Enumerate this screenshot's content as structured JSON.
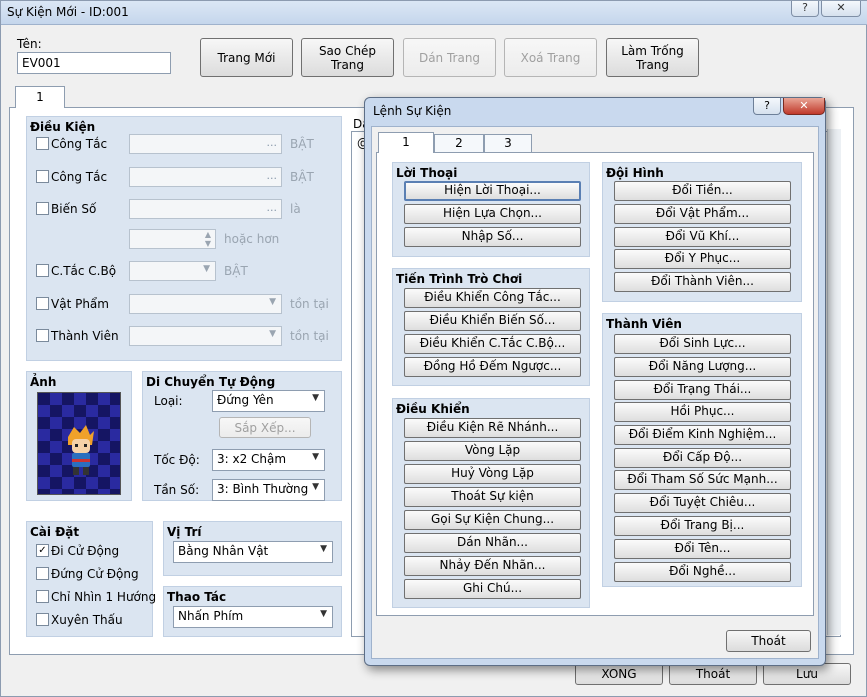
{
  "window": {
    "title": "Sự Kiện Mới - ID:001",
    "help_label": "?",
    "close_label": "✕"
  },
  "name_label": "Tên:",
  "name_value": "EV001",
  "toolbar": {
    "new_page": "Trang Mới",
    "copy_page": "Sao Chép Trang",
    "paste_page": "Dán Trang",
    "delete_page": "Xoá Trang",
    "clear_page": "Làm Trống Trang"
  },
  "page_tab": "1",
  "conditions": {
    "title": "Điều Kiện",
    "switch1_label": "Công Tắc",
    "switch1_suffix": "BẬT",
    "switch2_label": "Công Tắc",
    "switch2_suffix": "BẬT",
    "variable_label": "Biến Số",
    "variable_suffix": "là",
    "or_more": "hoặc hơn",
    "self_switch_label": "C.Tắc C.Bộ",
    "self_switch_suffix": "BẬT",
    "item_label": "Vật Phẩm",
    "item_suffix": "tồn tại",
    "actor_label": "Thành Viên",
    "actor_suffix": "tồn tại",
    "dots": "..."
  },
  "image": {
    "title": "Ảnh"
  },
  "autonomous": {
    "title": "Di Chuyển Tự Động",
    "type_label": "Loại:",
    "type_value": "Đứng Yên",
    "route_button": "Sắp Xếp...",
    "speed_label": "Tốc Độ:",
    "speed_value": "3: x2 Chậm",
    "freq_label": "Tần Số:",
    "freq_value": "3: Bình Thường"
  },
  "options": {
    "title": "Cài Đặt",
    "walking_anim": "Đi Cử Động",
    "stepping_anim": "Đứng Cử Động",
    "direction_fix": "Chỉ Nhìn 1 Hướng",
    "through": "Xuyên Thấu",
    "walking_checked": "✓"
  },
  "priority": {
    "title": "Vị Trí",
    "value": "Bằng Nhân Vật"
  },
  "trigger": {
    "title": "Thao Tác",
    "value": "Nhấn Phím"
  },
  "contents_label_partial": "Da",
  "contents_at": "@",
  "footer": {
    "ok": "XONG",
    "cancel": "Thoát",
    "apply": "Lưu"
  },
  "dialog": {
    "title": "Lệnh Sự Kiện",
    "help_label": "?",
    "close_label": "✕",
    "tabs": [
      "1",
      "2",
      "3"
    ],
    "message": {
      "title": "Lời Thoại",
      "items": [
        "Hiện Lời Thoại...",
        "Hiện Lựa Chọn...",
        "Nhập Số..."
      ]
    },
    "game_progression": {
      "title": "Tiến Trình Trò Chơi",
      "items": [
        "Điều Khiển Công Tắc...",
        "Điều Khiển Biến Số...",
        "Điều Khiển C.Tắc C.Bộ...",
        "Đồng Hồ Đếm Ngược..."
      ]
    },
    "flow_control": {
      "title": "Điều Khiển",
      "items": [
        "Điều Kiện Rẽ Nhánh...",
        "Vòng Lặp",
        "Huỷ Vòng Lặp",
        "Thoát Sự kiện",
        "Gọi Sự Kiện Chung...",
        "Dán Nhãn...",
        "Nhảy Đến Nhãn...",
        "Ghi Chú..."
      ]
    },
    "party": {
      "title": "Đội Hình",
      "items": [
        "Đổi Tiền...",
        "Đổi Vật Phẩm...",
        "Đổi Vũ Khí...",
        "Đổi Y Phục...",
        "Đổi Thành Viên..."
      ]
    },
    "actor": {
      "title": "Thành Viên",
      "items": [
        "Đổi Sinh Lực...",
        "Đổi Năng Lượng...",
        "Đổi Trạng Thái...",
        "Hồi Phục...",
        "Đổi Điểm Kinh Nghiệm...",
        "Đổi Cấp Độ...",
        "Đổi Tham Số Sức Mạnh...",
        "Đổi Tuyệt Chiêu...",
        "Đổi Trang Bị...",
        "Đổi Tên...",
        "Đổi Nghề..."
      ]
    },
    "close_button": "Thoát"
  }
}
